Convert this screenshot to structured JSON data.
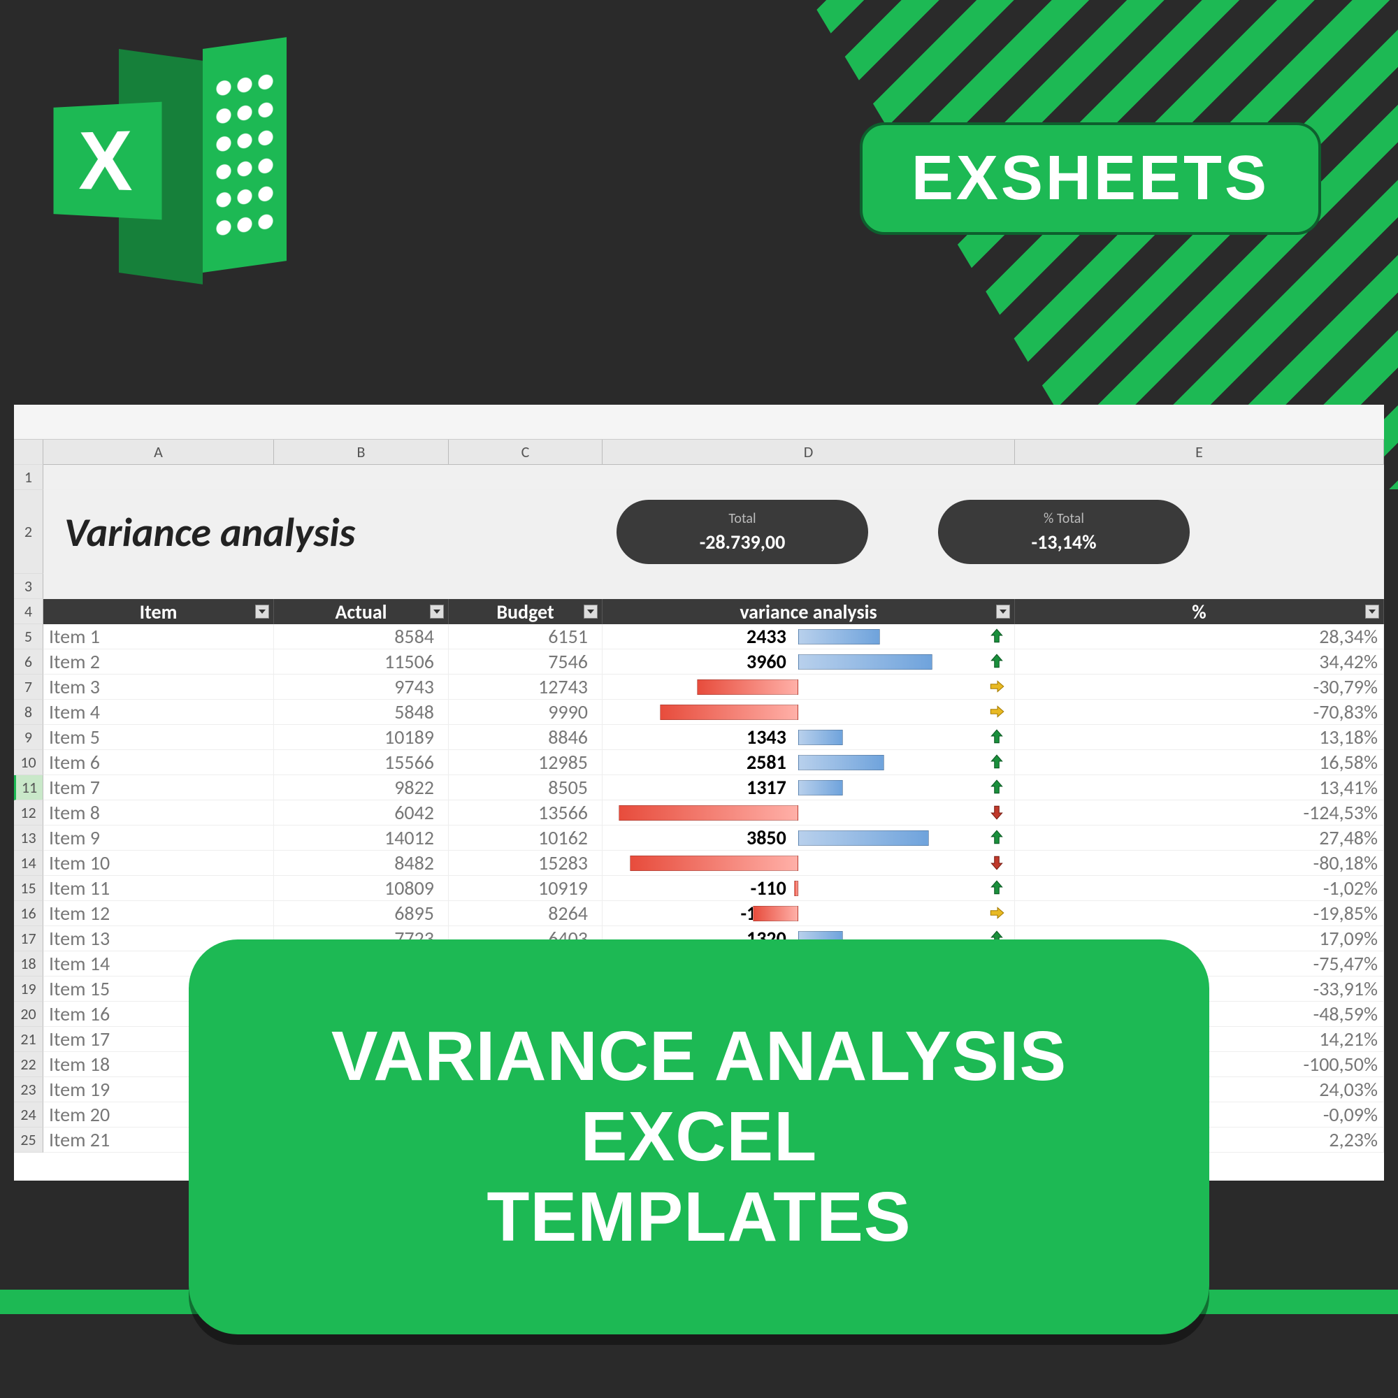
{
  "brand": "EXSHEETS",
  "banner": {
    "line1": "VARIANCE ANALYSIS EXCEL",
    "line2": "TEMPLATES"
  },
  "sheet": {
    "title": "Variance analysis",
    "columns": [
      "A",
      "B",
      "C",
      "D",
      "E"
    ],
    "pills": [
      {
        "label": "Total",
        "value": "-28.739,00"
      },
      {
        "label": "% Total",
        "value": "-13,14%"
      }
    ],
    "headers": {
      "item": "Item",
      "actual": "Actual",
      "budget": "Budget",
      "variance": "variance analysis",
      "pct": "%"
    },
    "rows": [
      {
        "n": 5,
        "item": "Item 1",
        "actual": "8584",
        "budget": "6151",
        "var": "2433",
        "barPct": 22,
        "dir": "up",
        "pct": "28,34%"
      },
      {
        "n": 6,
        "item": "Item 2",
        "actual": "11506",
        "budget": "7546",
        "var": "3960",
        "barPct": 36,
        "dir": "up",
        "pct": "34,42%"
      },
      {
        "n": 7,
        "item": "Item 3",
        "actual": "9743",
        "budget": "12743",
        "var": "-3000",
        "barPct": -27,
        "dir": "side",
        "pct": "-30,79%"
      },
      {
        "n": 8,
        "item": "Item 4",
        "actual": "5848",
        "budget": "9990",
        "var": "-4142",
        "barPct": -37,
        "dir": "side",
        "pct": "-70,83%"
      },
      {
        "n": 9,
        "item": "Item 5",
        "actual": "10189",
        "budget": "8846",
        "var": "1343",
        "barPct": 12,
        "dir": "up",
        "pct": "13,18%"
      },
      {
        "n": 10,
        "item": "Item 6",
        "actual": "15566",
        "budget": "12985",
        "var": "2581",
        "barPct": 23,
        "dir": "up",
        "pct": "16,58%"
      },
      {
        "n": 11,
        "item": "Item 7",
        "actual": "9822",
        "budget": "8505",
        "var": "1317",
        "barPct": 12,
        "dir": "up",
        "pct": "13,41%",
        "sel": true
      },
      {
        "n": 12,
        "item": "Item 8",
        "actual": "6042",
        "budget": "13566",
        "var": "-7524",
        "barPct": -48,
        "dir": "down",
        "pct": "-124,53%"
      },
      {
        "n": 13,
        "item": "Item 9",
        "actual": "14012",
        "budget": "10162",
        "var": "3850",
        "barPct": 35,
        "dir": "up",
        "pct": "27,48%"
      },
      {
        "n": 14,
        "item": "Item 10",
        "actual": "8482",
        "budget": "15283",
        "var": "-6801",
        "barPct": -45,
        "dir": "down",
        "pct": "-80,18%"
      },
      {
        "n": 15,
        "item": "Item 11",
        "actual": "10809",
        "budget": "10919",
        "var": "-110",
        "barPct": -1,
        "dir": "up",
        "pct": "-1,02%"
      },
      {
        "n": 16,
        "item": "Item 12",
        "actual": "6895",
        "budget": "8264",
        "var": "-1369",
        "barPct": -12,
        "dir": "side",
        "pct": "-19,85%"
      },
      {
        "n": 17,
        "item": "Item 13",
        "actual": "7723",
        "budget": "6403",
        "var": "1320",
        "barPct": 12,
        "dir": "up",
        "pct": "17,09%"
      },
      {
        "n": 18,
        "item": "Item 14",
        "actual": "",
        "budget": "",
        "var": "",
        "barPct": 0,
        "dir": "",
        "pct": "-75,47%"
      },
      {
        "n": 19,
        "item": "Item 15",
        "actual": "",
        "budget": "",
        "var": "",
        "barPct": 0,
        "dir": "",
        "pct": "-33,91%"
      },
      {
        "n": 20,
        "item": "Item 16",
        "actual": "",
        "budget": "",
        "var": "",
        "barPct": 0,
        "dir": "",
        "pct": "-48,59%"
      },
      {
        "n": 21,
        "item": "Item 17",
        "actual": "",
        "budget": "",
        "var": "",
        "barPct": 0,
        "dir": "",
        "pct": "14,21%"
      },
      {
        "n": 22,
        "item": "Item 18",
        "actual": "",
        "budget": "",
        "var": "",
        "barPct": 0,
        "dir": "",
        "pct": "-100,50%"
      },
      {
        "n": 23,
        "item": "Item 19",
        "actual": "",
        "budget": "",
        "var": "",
        "barPct": 0,
        "dir": "",
        "pct": "24,03%"
      },
      {
        "n": 24,
        "item": "Item 20",
        "actual": "",
        "budget": "",
        "var": "",
        "barPct": 0,
        "dir": "",
        "pct": "-0,09%"
      },
      {
        "n": 25,
        "item": "Item 21",
        "actual": "",
        "budget": "",
        "var": "",
        "barPct": 0,
        "dir": "",
        "pct": "2,23%"
      }
    ]
  }
}
